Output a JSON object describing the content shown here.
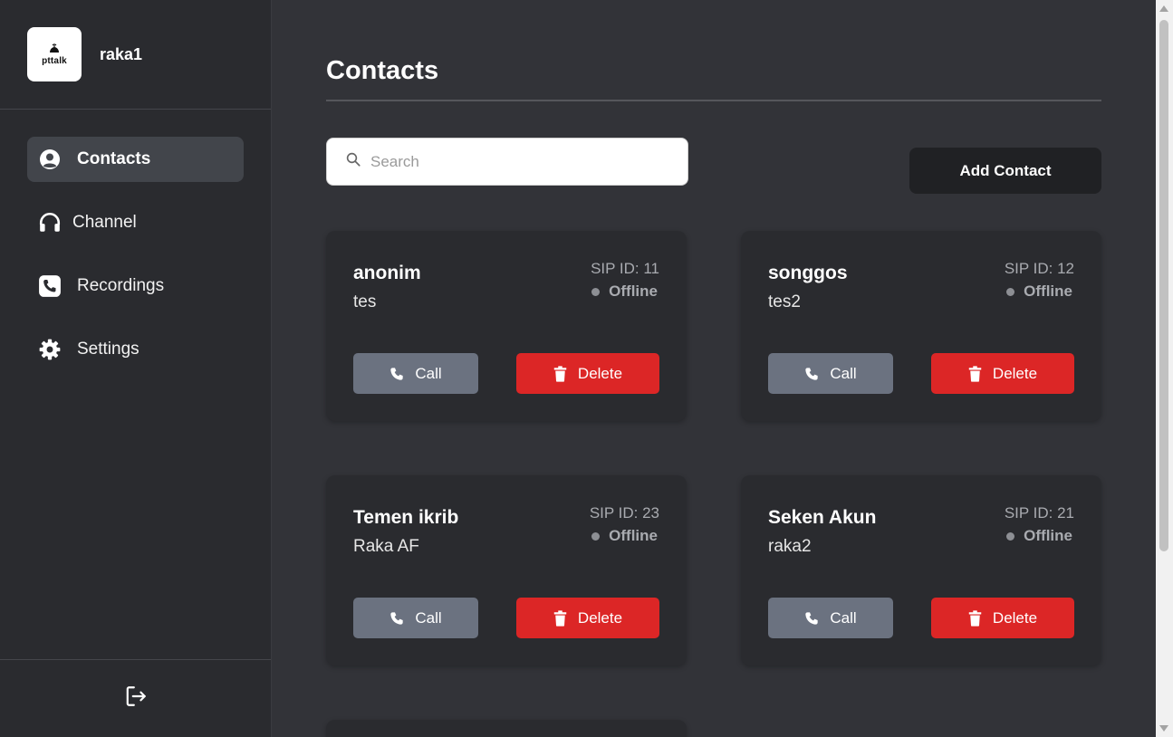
{
  "app": {
    "logo_text": "pttalk",
    "username": "raka1"
  },
  "sidebar": {
    "items": [
      {
        "label": "Contacts",
        "icon": "user-circle-icon",
        "active": true
      },
      {
        "label": "Channel",
        "icon": "headphones-icon",
        "active": false
      },
      {
        "label": "Recordings",
        "icon": "phone-square-icon",
        "active": false
      },
      {
        "label": "Settings",
        "icon": "gear-icon",
        "active": false
      }
    ],
    "footer_icon": "logout-icon"
  },
  "main": {
    "title": "Contacts",
    "search_placeholder": "Search",
    "search_value": "",
    "add_contact_label": "Add Contact"
  },
  "contacts": [
    {
      "name": "anonim",
      "sub": "tes",
      "sip": "SIP ID: 11",
      "status": "Offline",
      "call_label": "Call",
      "delete_label": "Delete"
    },
    {
      "name": "songgos",
      "sub": "tes2",
      "sip": "SIP ID: 12",
      "status": "Offline",
      "call_label": "Call",
      "delete_label": "Delete"
    },
    {
      "name": "Temen ikrib",
      "sub": "Raka AF",
      "sip": "SIP ID: 23",
      "status": "Offline",
      "call_label": "Call",
      "delete_label": "Delete"
    },
    {
      "name": "Seken Akun",
      "sub": "raka2",
      "sip": "SIP ID: 21",
      "status": "Offline",
      "call_label": "Call",
      "delete_label": "Delete"
    }
  ],
  "colors": {
    "sidebar_bg": "#2a2b2f",
    "main_bg": "#323338",
    "active_nav": "#42454b",
    "call_button": "#6b7280",
    "delete_button": "#dc2626",
    "add_button": "#202124",
    "offline_dot": "#8d8f94"
  }
}
